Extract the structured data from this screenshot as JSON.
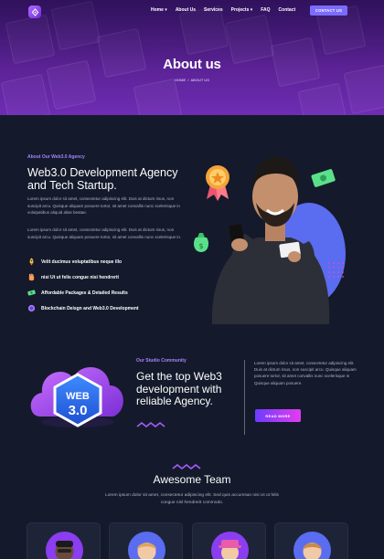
{
  "nav": {
    "links": [
      "Home",
      "About Us",
      "Services",
      "Projects",
      "FAQ",
      "Contact"
    ],
    "contact_button": "CONTACT US"
  },
  "hero": {
    "title": "About us",
    "breadcrumb": [
      "HOME",
      "/",
      "ABOUT US"
    ]
  },
  "about": {
    "eyebrow": "About Our Web3.0 Agency",
    "heading": "Web3.0 Development Agency and Tech Startup.",
    "paragraph1": "Lorem ipsum dolor sit amet, consectetur adipiscing elit. Duis at dictum risus, non suscipit arcu. Quisque aliquam posuere tortor, sit amet convallis nunc scelerisque in volutpatibus aliquid alias beatae.",
    "paragraph2": "Lorem ipsum dolor sit amet, consectetur adipiscing elit. Duis at dictum risus, non suscipit arcu. Quisque aliquam posuere tortor, sit amet convallis nunc scelerisque in.",
    "features": [
      {
        "label": "Velit ducimus voluptatibus neque illo",
        "icon": "rocket-icon",
        "color": "#f5c542"
      },
      {
        "label": "nisi Ut ut felis congue nisi hendrerit",
        "icon": "hand-icon",
        "color": "#ff9d4d"
      },
      {
        "label": "Affordable Packages & Detailed Results",
        "icon": "money-icon",
        "color": "#5be08a"
      },
      {
        "label": "Blockchain Deisgn and Web3.0 Development",
        "icon": "coin-icon",
        "color": "#a782ff"
      }
    ]
  },
  "studio": {
    "eyebrow": "Our Studio Community",
    "heading": "Get the top Web3 development with reliable Agency.",
    "paragraph": "Lorem ipsum dolor sit amet, consectetur adipiscing elit. Duis at dictum risus, non suscipit arcu. Quisque aliquam posuere tortor, sit amet convallis nunc scelerisque in Quisque aliquam posuere.",
    "button": "READ MORE",
    "badge_text": "WEB 3.0"
  },
  "team": {
    "title": "Awesome Team",
    "description": "Lorem ipsum dolor sit amet, consectetur adipiscing elit. Sed quis accumsan nisi Ut ut felis congue nisl hendrerit commodo."
  },
  "colors": {
    "accent": "#7b6cff",
    "eyebrow": "#a782ff",
    "background": "#141a2b",
    "gradient_start": "#6d3bff",
    "gradient_end": "#e43cf0"
  }
}
